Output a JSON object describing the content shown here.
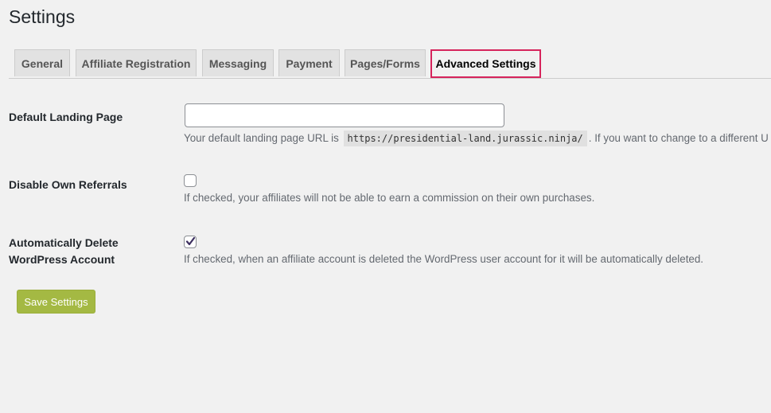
{
  "page": {
    "title": "Settings"
  },
  "tabs": [
    {
      "label": "General",
      "active": false
    },
    {
      "label": "Affiliate Registration",
      "active": false
    },
    {
      "label": "Messaging",
      "active": false
    },
    {
      "label": "Payment",
      "active": false
    },
    {
      "label": "Pages/Forms",
      "active": false
    },
    {
      "label": "Advanced Settings",
      "active": true
    }
  ],
  "fields": {
    "landing_page": {
      "label": "Default Landing Page",
      "value": "",
      "desc_prefix": "Your default landing page URL is",
      "desc_url": "https://presidential-land.jurassic.ninja/",
      "desc_suffix": ". If you want to change to a different U"
    },
    "disable_own_referrals": {
      "label": "Disable Own Referrals",
      "checked": false,
      "desc": "If checked, your affiliates will not be able to earn a commission on their own purchases."
    },
    "auto_delete": {
      "label_line1": "Automatically Delete",
      "label_line2": "WordPress Account",
      "checked": true,
      "desc": "If checked, when an affiliate account is deleted the WordPress user account for it will be automatically deleted."
    }
  },
  "actions": {
    "save_label": "Save Settings"
  },
  "colors": {
    "active_tab_border": "#d6245c",
    "save_button": "#a4b943",
    "checkmark": "#3c2f5f"
  }
}
